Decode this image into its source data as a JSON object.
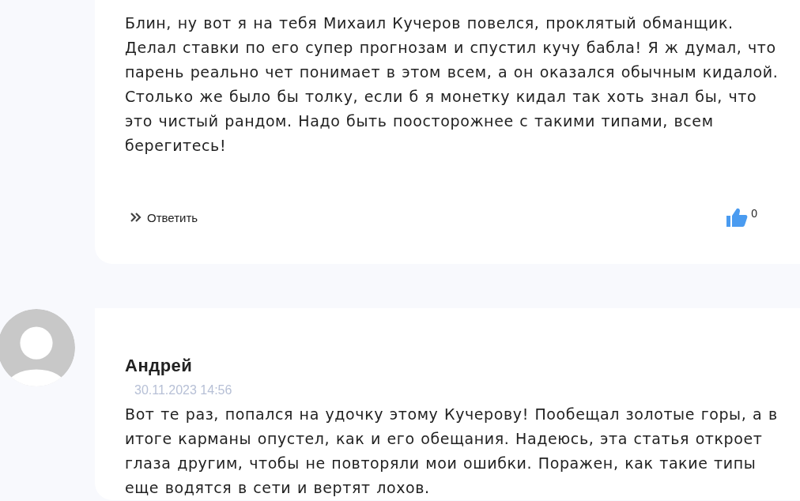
{
  "comments": [
    {
      "text": "Блин, ну вот я на тебя Михаил Кучеров повелся, проклятый обманщик. Делал ставки по его супер прогнозам и спустил кучу бабла! Я ж думал, что парень реально чет понимает в этом всем, а он оказался обычным кидалой. Столько же было бы толку, если б я монетку кидал так хоть знал бы, что это чистый рандом. Надо быть поосторожнее с такими типами, всем берегитесь!",
      "reply_label": "Ответить",
      "likes": "0"
    },
    {
      "author": "Андрей",
      "date": "30.11.2023 14:56",
      "text": "Вот те раз, попался на удочку этому Кучерову! Пообещал золотые горы, а в итоге карманы опустел, как и его обещания. Надеюсь, эта статья откроет глаза другим, чтобы не повторяли мои ошибки. Поражен, как такие типы еще водятся в сети и вертят лохов."
    }
  ]
}
